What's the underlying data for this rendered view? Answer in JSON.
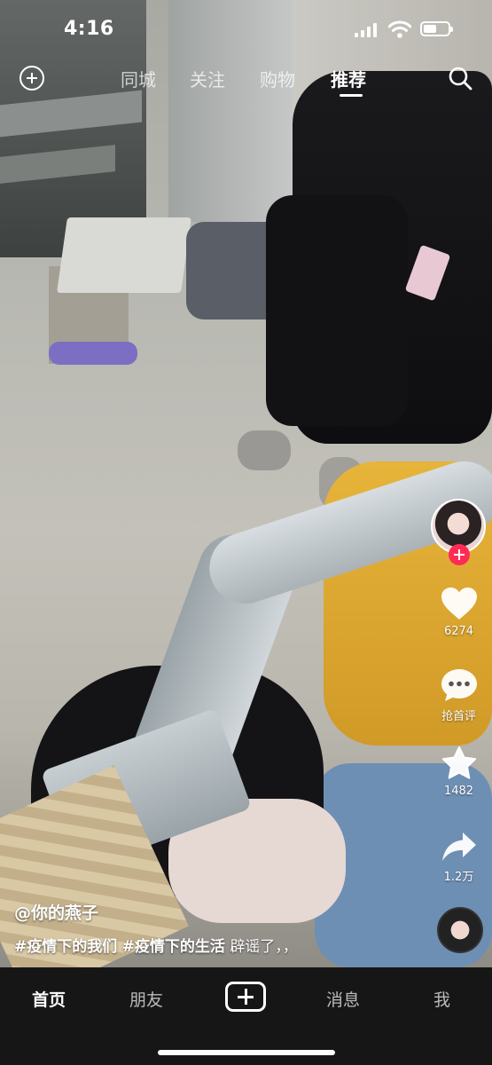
{
  "status_bar": {
    "time": "4:16"
  },
  "top_nav": {
    "tabs": [
      {
        "label": "同城",
        "active": false
      },
      {
        "label": "关注",
        "active": false
      },
      {
        "label": "购物",
        "active": false
      },
      {
        "label": "推荐",
        "active": true
      }
    ],
    "left_icon": "add-circle-icon",
    "right_icon": "search-icon"
  },
  "actions": {
    "like_count": "6274",
    "comment_label": "抢首评",
    "favorite_count": "1482",
    "share_count": "1.2万"
  },
  "caption": {
    "author": "@你的燕子",
    "hashtags": [
      "#疫情下的我们",
      "#疫情下的生活"
    ],
    "text": "辟谣了，，"
  },
  "bottom_nav": {
    "home": "首页",
    "friends": "朋友",
    "messages": "消息",
    "me": "我",
    "create_icon": "plus-icon"
  },
  "colors": {
    "accent": "#fe2c55",
    "nav_bg": "#161616"
  }
}
